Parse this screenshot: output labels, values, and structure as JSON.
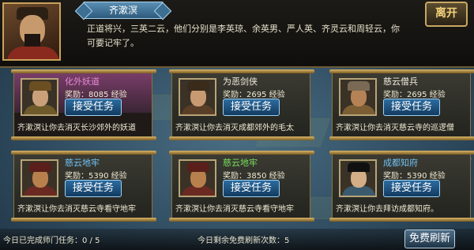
{
  "npc": {
    "name": "齐漱溟",
    "dialog": "正道将兴，三英二云，他们分别是李英琼、余英男、严人英、齐灵云和周轻云，你可要记牢了。"
  },
  "header": {
    "leave_label": "离开"
  },
  "cards": [
    {
      "title": "化外妖道",
      "title_color": "#e58ad6",
      "reward": "奖励：8085 经验",
      "accept": "接受任务",
      "desc": "齐漱溟让你去消灭长沙郊外的妖道",
      "theme": "pink",
      "avatar": {
        "face": "#caa07a",
        "hat": "#6b4e22",
        "body": "#6f5a2b"
      }
    },
    {
      "title": "为恶剑侠",
      "title_color": "#f2ede0",
      "reward": "奖励：2695 经验",
      "accept": "接受任务",
      "desc": "齐漱溟让你去消灭成都郊外的毛太",
      "theme": "plain",
      "avatar": {
        "face": "#c89a72",
        "hat": "#3a2a1a",
        "body": "#5a3f28"
      }
    },
    {
      "title": "慈云僧兵",
      "title_color": "#f2ede0",
      "reward": "奖励：2695 经验",
      "accept": "接受任务",
      "desc": "齐漱溟让你去消灭慈云寺的巡逻僧",
      "theme": "plain",
      "avatar": {
        "face": "#b58256",
        "hat": "#7a6a55",
        "body": "#7b5e34"
      }
    },
    {
      "title": "慈云地牢",
      "title_color": "#6fc3f5",
      "reward": "奖励：5390 经验",
      "accept": "接受任务",
      "desc": "齐漱溟让你去消灭慈云寺看守地牢",
      "theme": "plain",
      "avatar": {
        "face": "#b8804d",
        "hat": "#5a1f1a",
        "body": "#6a2a22"
      }
    },
    {
      "title": "慈云地牢",
      "title_color": "#78e05a",
      "reward": "奖励：3850 经验",
      "accept": "接受任务",
      "desc": "齐漱溟让你去消灭慈云寺看守地牢",
      "theme": "plain",
      "avatar": {
        "face": "#b8804d",
        "hat": "#5a1f1a",
        "body": "#6a2a22"
      }
    },
    {
      "title": "成都知府",
      "title_color": "#6fc3f5",
      "reward": "奖励：5390 经验",
      "accept": "接受任务",
      "desc": "齐漱溟让你去拜访成都知府。",
      "theme": "plain",
      "avatar": {
        "face": "#d3ad86",
        "hat": "#101010",
        "body": "#3b5a6e"
      }
    }
  ],
  "footer": {
    "done_text": "今日已完成师门任务：0 / 5",
    "refresh_text": "今日剩余免费刷新次数：5",
    "free_refresh_label": "免费刷新"
  }
}
